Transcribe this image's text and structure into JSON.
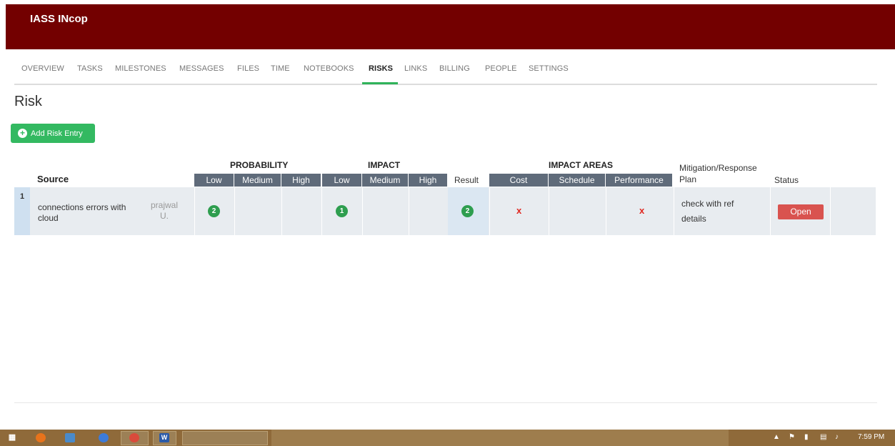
{
  "app": {
    "title": "IASS INcop"
  },
  "nav": {
    "tabs": [
      "OVERVIEW",
      "TASKS",
      "MILESTONES",
      "MESSAGES",
      "FILES",
      "TIME",
      "NOTEBOOKS",
      "RISKS",
      "LINKS",
      "BILLING",
      "PEOPLE",
      "SETTINGS"
    ],
    "active": "RISKS"
  },
  "page": {
    "title": "Risk",
    "add_button": "Add Risk Entry"
  },
  "table": {
    "headers": {
      "source": "Source",
      "probability": "PROBABILITY",
      "impact": "IMPACT",
      "impact_areas": "IMPACT AREAS",
      "mitigation_line1": "Mitigation/Response",
      "mitigation_line2": "Plan",
      "result": "Result",
      "status": "Status"
    },
    "probability_levels": [
      "Low",
      "Medium",
      "High"
    ],
    "impact_levels": [
      "Low",
      "Medium",
      "High"
    ],
    "impact_area_columns": [
      "Cost",
      "Schedule",
      "Performance"
    ],
    "rows": [
      {
        "num": "1",
        "source_line1": "connections errors with",
        "source_line2": "cloud",
        "owner_line1": "prajwal",
        "owner_line2": "U.",
        "probability": "2",
        "impact": "1",
        "result": "2",
        "cost_mark": "x",
        "performance_mark": "x",
        "plan_line1": "check with ref",
        "plan_line2": "details",
        "status": "Open"
      }
    ]
  },
  "colors": {
    "header": "#730000",
    "accent_green": "#33b961",
    "status_red": "#d9534f",
    "subheader": "#5f6b7a"
  },
  "taskbar": {
    "clock": "7:59 PM"
  }
}
